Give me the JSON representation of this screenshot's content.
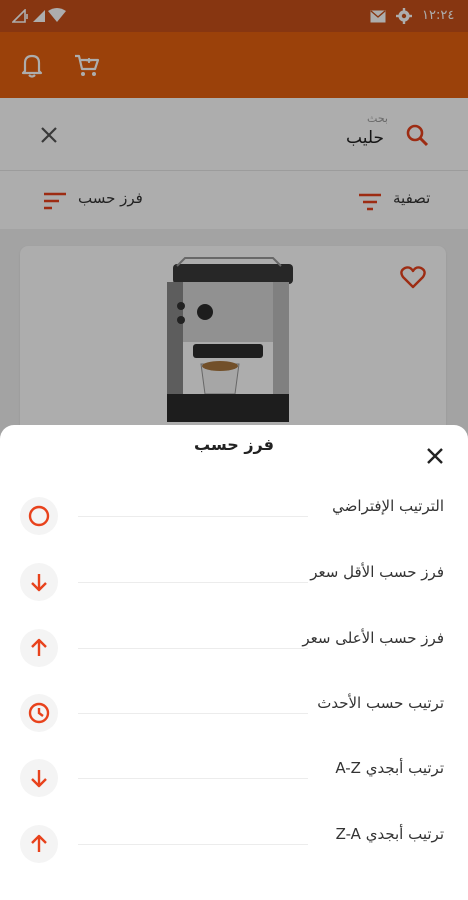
{
  "status_bar": {
    "time": "١٢:٢٤"
  },
  "search": {
    "hint": "بحث",
    "value": "حليب"
  },
  "filter_bar": {
    "filter_label": "تصفية",
    "sort_label": "فرز حسب"
  },
  "sort_sheet": {
    "title": "فرز حسب",
    "options": [
      {
        "label": "الترتيب الإفتراضي",
        "icon": "circle-icon"
      },
      {
        "label": "فرز حسب الأقل سعر",
        "icon": "arrow-down-icon"
      },
      {
        "label": "فرز حسب الأعلى سعر",
        "icon": "arrow-up-icon"
      },
      {
        "label": "ترتيب حسب الأحدث",
        "icon": "clock-icon"
      },
      {
        "label": "ترتيب أبجدي A-Z",
        "icon": "arrow-down-icon"
      },
      {
        "label": "ترتيب أبجدي Z-A",
        "icon": "arrow-up-icon"
      }
    ]
  },
  "colors": {
    "accent": "#e5600f",
    "icon_accent": "#e8421c"
  }
}
